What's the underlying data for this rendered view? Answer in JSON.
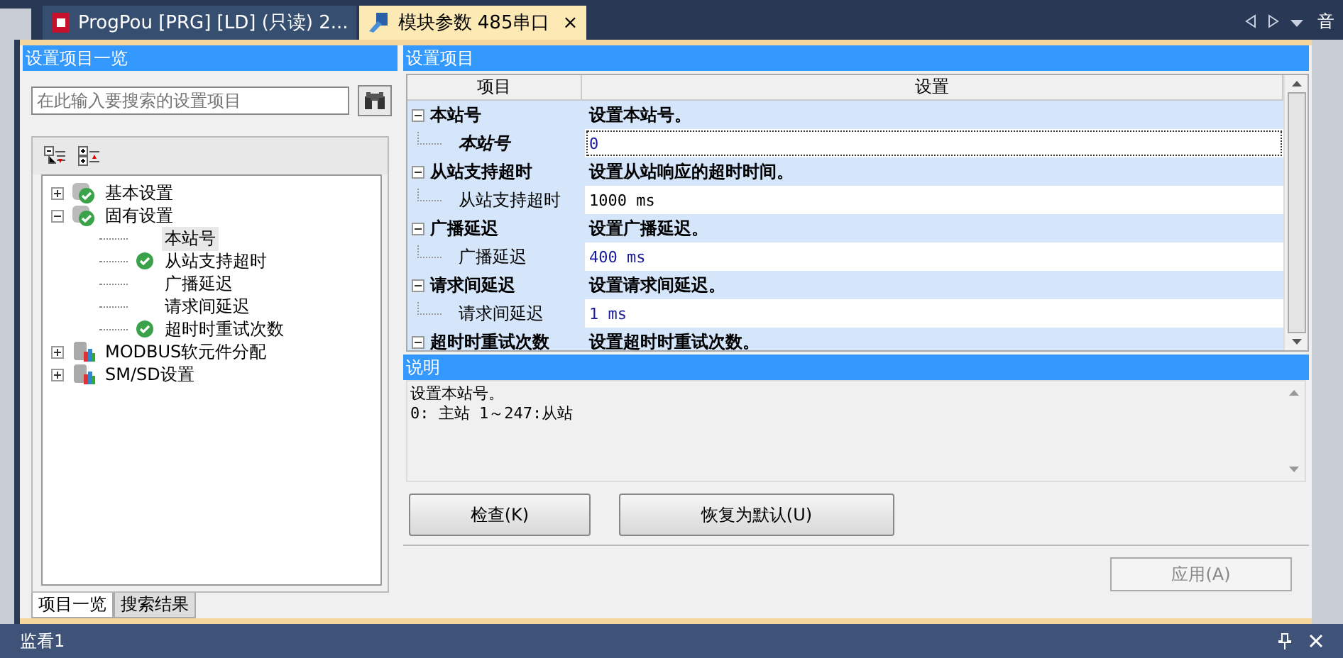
{
  "tabs": [
    {
      "label": "ProgPou [PRG] [LD] (只读) 2...",
      "kind": "program",
      "selected": false
    },
    {
      "label": "模块参数 485串口",
      "kind": "module",
      "selected": true,
      "close": "×"
    }
  ],
  "side_strip": {
    "label": "音"
  },
  "left_panel": {
    "title": "设置项目一览",
    "search": {
      "placeholder": "在此输入要搜索的设置项目"
    },
    "tree": [
      {
        "label": "基本设置",
        "kind": "checked",
        "expanded": false,
        "selected": false
      },
      {
        "label": "固有设置",
        "kind": "checked",
        "expanded": true,
        "selected": false,
        "children": [
          {
            "label": "本站号",
            "kind": "plain",
            "selected": true
          },
          {
            "label": "从站支持超时",
            "kind": "checked",
            "selected": false
          },
          {
            "label": "广播延迟",
            "kind": "plain",
            "selected": false
          },
          {
            "label": "请求间延迟",
            "kind": "plain",
            "selected": false
          },
          {
            "label": "超时时重试次数",
            "kind": "checked",
            "selected": false
          }
        ]
      },
      {
        "label": "MODBUS软元件分配",
        "kind": "device",
        "expanded": false,
        "selected": false
      },
      {
        "label": "SM/SD设置",
        "kind": "device",
        "expanded": false,
        "selected": false
      }
    ],
    "bottom_tabs": [
      {
        "label": "项目一览",
        "selected": true
      },
      {
        "label": "搜索结果",
        "selected": false
      }
    ]
  },
  "right_panel": {
    "title": "设置项目",
    "columns": [
      "项目",
      "设置"
    ],
    "groups": [
      {
        "name": "本站号",
        "description": "设置本站号。",
        "items": [
          {
            "name": "本站号",
            "value": "0",
            "modified": true,
            "selected": true
          }
        ]
      },
      {
        "name": "从站支持超时",
        "description": "设置从站响应的超时时间。",
        "items": [
          {
            "name": "从站支持超时",
            "value": "1000 ms",
            "modified": false,
            "selected": false
          }
        ]
      },
      {
        "name": "广播延迟",
        "description": "设置广播延迟。",
        "items": [
          {
            "name": "广播延迟",
            "value": "400 ms",
            "modified": true,
            "selected": false
          }
        ]
      },
      {
        "name": "请求间延迟",
        "description": "设置请求间延迟。",
        "items": [
          {
            "name": "请求间延迟",
            "value": "1 ms",
            "modified": true,
            "selected": false
          }
        ]
      },
      {
        "name": "超时时重试次数",
        "description": "设置超时时重试次数。"
      }
    ],
    "explanation": {
      "title": "说明",
      "lines": [
        "设置本站号。",
        "0: 主站  1～247:从站"
      ]
    },
    "buttons": [
      "检查(K)",
      "恢复为默认(U)"
    ],
    "apply": {
      "label": "应用(A)",
      "disabled": true
    }
  },
  "bottom_panel": {
    "title": "监看1"
  }
}
